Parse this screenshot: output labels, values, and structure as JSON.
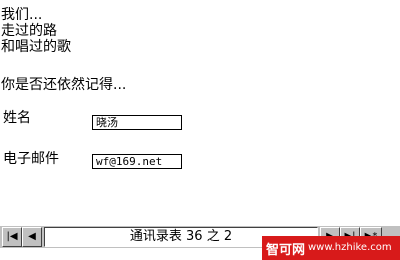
{
  "intro": {
    "line1": "我们...",
    "line2": "走过的路",
    "line3": "和唱过的歌",
    "line4": "你是否还依然记得..."
  },
  "form": {
    "name_label": "姓名",
    "name_value": "晓汤",
    "email_label": "电子邮件",
    "email_value": "wf@169.net"
  },
  "nav": {
    "status": "通讯录表 36 之 2",
    "first_glyph": "|◀",
    "prev_glyph": "◀",
    "next_glyph": "▶",
    "last_glyph": "▶|",
    "new_glyph": "▶*"
  },
  "watermark": {
    "brand": "智可网",
    "url": "www.hzhike.com"
  },
  "colors": {
    "toolbar_bg": "#c0c0c0",
    "watermark_bg": "#d81a1a"
  }
}
